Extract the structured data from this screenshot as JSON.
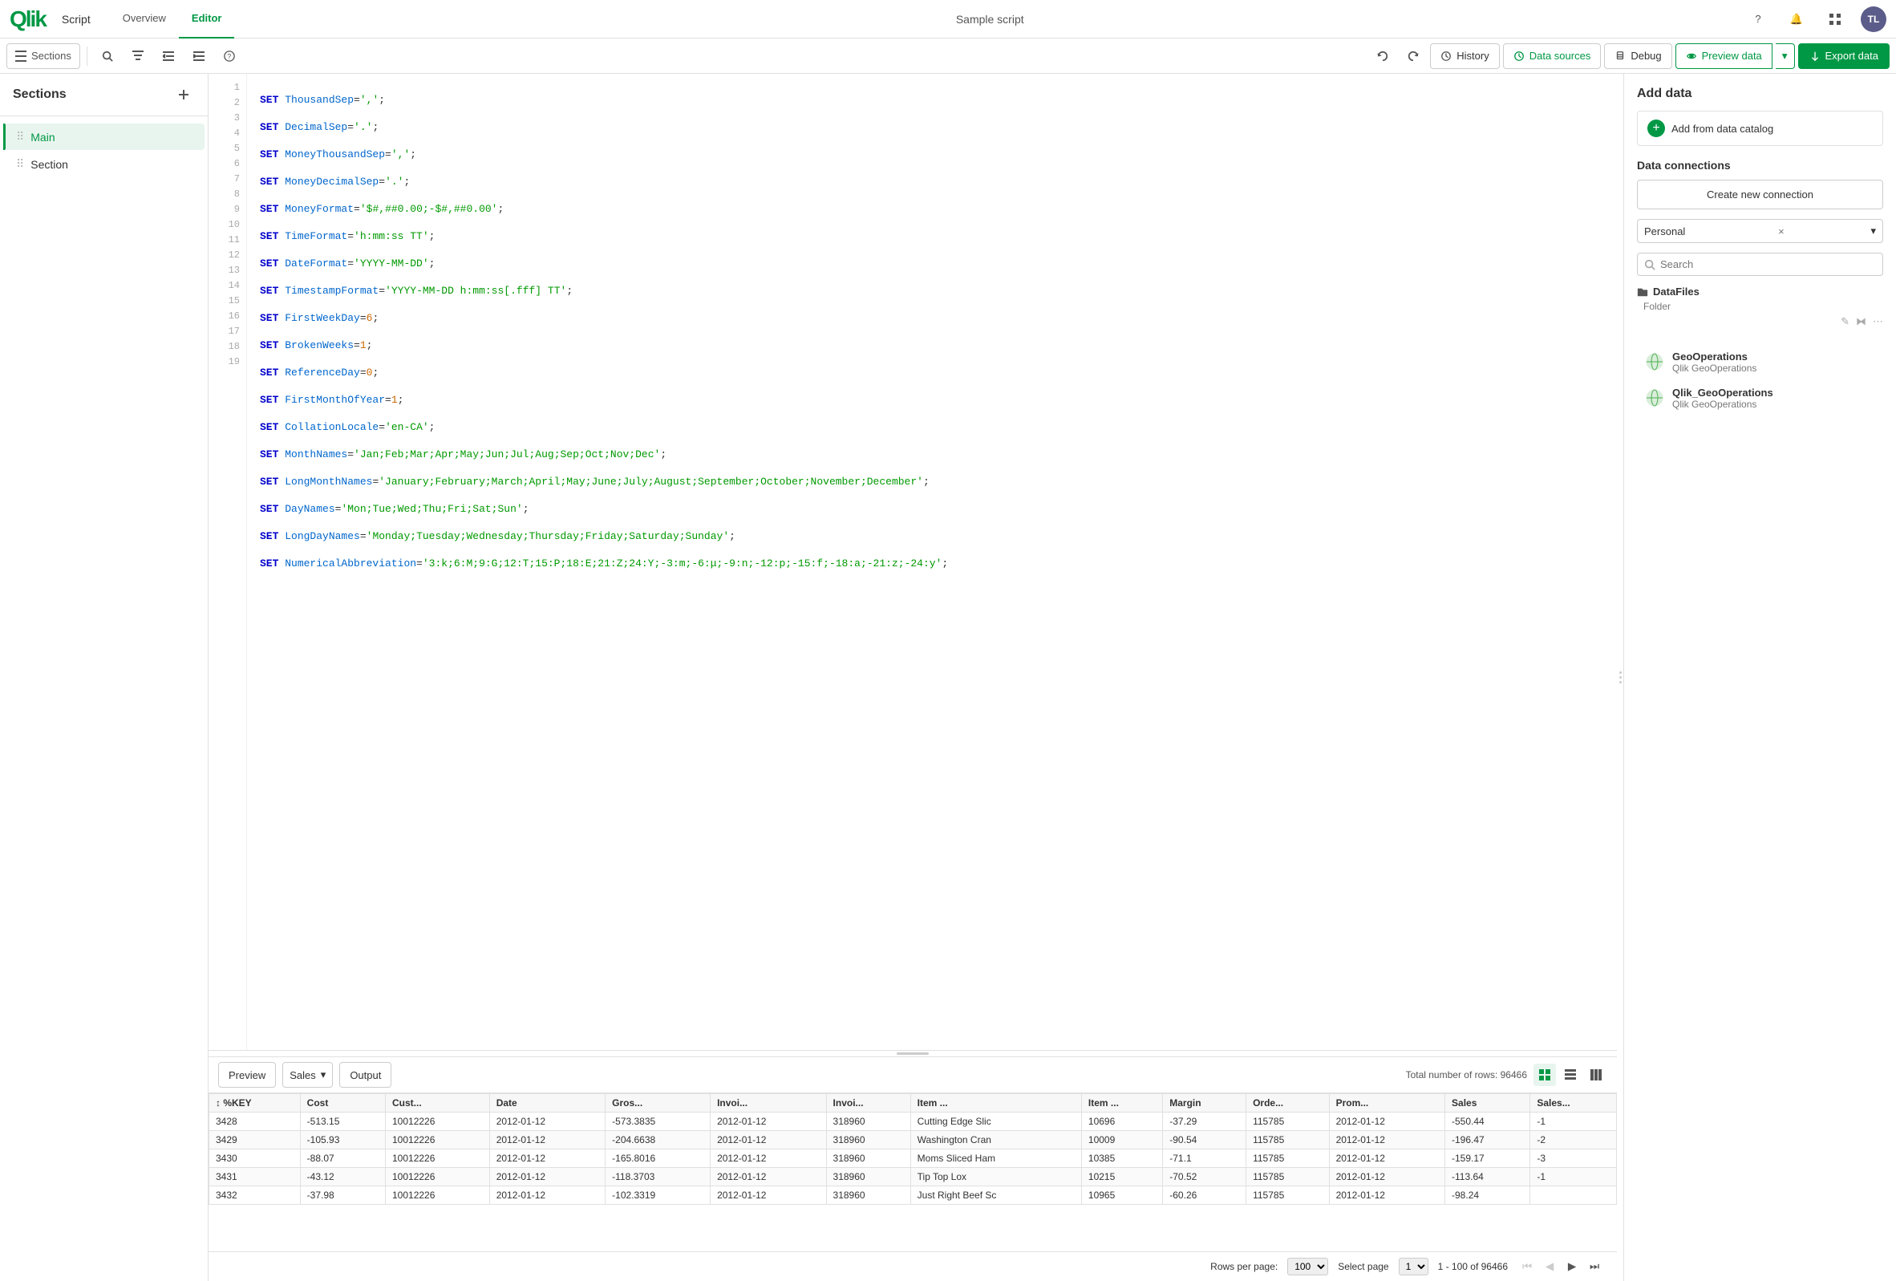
{
  "app": {
    "title": "Sample script",
    "logo": "Qlik"
  },
  "nav": {
    "script_label": "Script",
    "overview_label": "Overview",
    "editor_label": "Editor"
  },
  "toolbar": {
    "sections_label": "Sections",
    "history_label": "History",
    "data_sources_label": "Data sources",
    "debug_label": "Debug",
    "preview_label": "Preview data",
    "export_label": "Export data",
    "help_tooltip": "Help",
    "undo_tooltip": "Undo",
    "redo_tooltip": "Redo"
  },
  "sidebar": {
    "title": "Sections",
    "add_tooltip": "Add section",
    "items": [
      {
        "label": "Main",
        "active": true
      },
      {
        "label": "Section",
        "active": false
      }
    ]
  },
  "editor": {
    "lines": [
      {
        "num": 1,
        "code": "SET ThousandSep=',';",
        "type": "set"
      },
      {
        "num": 2,
        "code": "SET DecimalSep='.';",
        "type": "set"
      },
      {
        "num": 3,
        "code": "SET MoneyThousandSep=',';",
        "type": "set"
      },
      {
        "num": 4,
        "code": "SET MoneyDecimalSep='.';",
        "type": "set"
      },
      {
        "num": 5,
        "code": "SET MoneyFormat='$#,##0.00;-$#,##0.00';",
        "type": "set"
      },
      {
        "num": 6,
        "code": "SET TimeFormat='h:mm:ss TT';",
        "type": "set"
      },
      {
        "num": 7,
        "code": "SET DateFormat='YYYY-MM-DD';",
        "type": "set"
      },
      {
        "num": 8,
        "code": "SET TimestampFormat='YYYY-MM-DD h:mm:ss[.fff] TT';",
        "type": "set"
      },
      {
        "num": 9,
        "code": "SET FirstWeekDay=6;",
        "type": "set"
      },
      {
        "num": 10,
        "code": "SET BrokenWeeks=1;",
        "type": "set"
      },
      {
        "num": 11,
        "code": "SET ReferenceDay=0;",
        "type": "set"
      },
      {
        "num": 12,
        "code": "SET FirstMonthOfYear=1;",
        "type": "set"
      },
      {
        "num": 13,
        "code": "SET CollationLocale='en-CA';",
        "type": "set"
      },
      {
        "num": 14,
        "code": "SET MonthNames='Jan;Feb;Mar;Apr;May;Jun;Jul;Aug;Sep;Oct;Nov;Dec';",
        "type": "set"
      },
      {
        "num": 15,
        "code": "SET LongMonthNames='January;February;March;April;May;June;July;August;September;October;November;December';",
        "type": "set"
      },
      {
        "num": 16,
        "code": "SET DayNames='Mon;Tue;Wed;Thu;Fri;Sat;Sun';",
        "type": "set"
      },
      {
        "num": 17,
        "code": "SET LongDayNames='Monday;Tuesday;Wednesday;Thursday;Friday;Saturday;Sunday';",
        "type": "set"
      },
      {
        "num": 18,
        "code": "SET NumericalAbbreviation='3:k;6:M;9:G;12:T;15:P;18:E;21:Z;24:Y;-3:m;-6:μ;-9:n;-12:p;-15:f;-18:a;-21:z;-24:y';",
        "type": "set"
      },
      {
        "num": 19,
        "code": "",
        "type": "empty"
      }
    ]
  },
  "right_panel": {
    "add_data_title": "Add data",
    "add_catalog_label": "Add from data catalog",
    "data_connections_title": "Data connections",
    "create_connection_label": "Create new connection",
    "filter": {
      "label": "Personal",
      "clear": "×"
    },
    "search_placeholder": "Search",
    "connections": [
      {
        "type": "folder",
        "name": "DataFiles",
        "sub": "Folder"
      },
      {
        "type": "globe",
        "name": "GeoOperations",
        "sub": "Qlik GeoOperations"
      },
      {
        "type": "globe",
        "name": "Qlik_GeoOperations",
        "sub": "Qlik GeoOperations"
      }
    ]
  },
  "preview": {
    "label": "Preview",
    "dropdown_label": "Sales",
    "output_label": "Output",
    "rows_total": "Total number of rows: 96466",
    "columns": [
      "%KEY",
      "Cost",
      "Cust...",
      "Date",
      "Gros...",
      "Invoi...",
      "Invoi...",
      "Item ...",
      "Item ...",
      "Margin",
      "Orde...",
      "Prom...",
      "Sales",
      "Sales..."
    ],
    "rows": [
      {
        "key": "3428",
        "cost": "-513.15",
        "cust": "10012226",
        "date": "2012-01-12",
        "gros": "-573.3835",
        "invoi1": "2012-01-12",
        "invoi2": "318960",
        "item1": "Cutting Edge Slic",
        "item2": "10696",
        "margin": "-37.29",
        "orde": "115785",
        "prom": "2012-01-12",
        "sales": "-550.44",
        "salesx": "-1"
      },
      {
        "key": "3429",
        "cost": "-105.93",
        "cust": "10012226",
        "date": "2012-01-12",
        "gros": "-204.6638",
        "invoi1": "2012-01-12",
        "invoi2": "318960",
        "item1": "Washington Cran",
        "item2": "10009",
        "margin": "-90.54",
        "orde": "115785",
        "prom": "2012-01-12",
        "sales": "-196.47",
        "salesx": "-2"
      },
      {
        "key": "3430",
        "cost": "-88.07",
        "cust": "10012226",
        "date": "2012-01-12",
        "gros": "-165.8016",
        "invoi1": "2012-01-12",
        "invoi2": "318960",
        "item1": "Moms Sliced Ham",
        "item2": "10385",
        "margin": "-71.1",
        "orde": "115785",
        "prom": "2012-01-12",
        "sales": "-159.17",
        "salesx": "-3"
      },
      {
        "key": "3431",
        "cost": "-43.12",
        "cust": "10012226",
        "date": "2012-01-12",
        "gros": "-118.3703",
        "invoi1": "2012-01-12",
        "invoi2": "318960",
        "item1": "Tip Top Lox",
        "item2": "10215",
        "margin": "-70.52",
        "orde": "115785",
        "prom": "2012-01-12",
        "sales": "-113.64",
        "salesx": "-1"
      },
      {
        "key": "3432",
        "cost": "-37.98",
        "cust": "10012226",
        "date": "2012-01-12",
        "gros": "-102.3319",
        "invoi1": "2012-01-12",
        "invoi2": "318960",
        "item1": "Just Right Beef Sc",
        "item2": "10965",
        "margin": "-60.26",
        "orde": "115785",
        "prom": "2012-01-12",
        "sales": "-98.24",
        "salesx": ""
      }
    ]
  },
  "pagination": {
    "rows_per_page_label": "Rows per page:",
    "rows_per_page_value": "100",
    "select_page_label": "Select page",
    "page_value": "1",
    "range_label": "1 - 100 of 96466"
  }
}
